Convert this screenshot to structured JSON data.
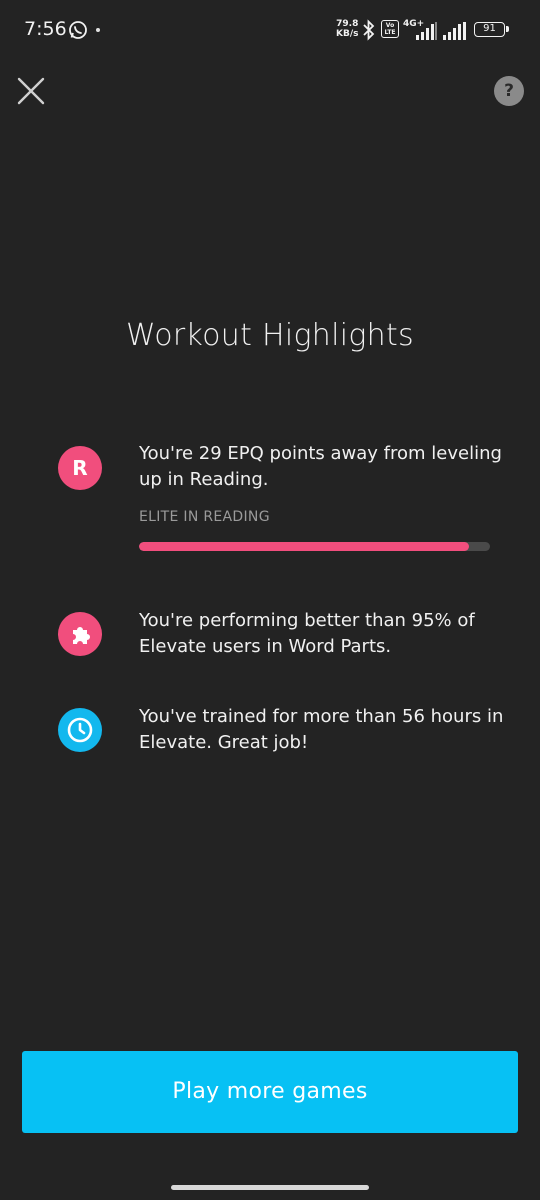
{
  "status_bar": {
    "time": "7:56",
    "net_speed_value": "79.8",
    "net_speed_unit": "KB/s",
    "volte_label": "Vo LTE",
    "network_type": "4G+",
    "battery_level": "91",
    "icons": [
      "whatsapp-icon",
      "bluetooth-icon",
      "signal-icon",
      "battery-icon"
    ]
  },
  "header": {
    "close_icon": "close-icon",
    "help_label": "?"
  },
  "main": {
    "title": "Workout Highlights",
    "highlights": [
      {
        "icon": "reading-r-icon",
        "icon_letter": "R",
        "icon_color": "#f14e7d",
        "text": "You're 29 EPQ points away from leveling up in Reading.",
        "level_label": "ELITE IN READING",
        "progress_fraction": 0.94
      },
      {
        "icon": "puzzle-icon",
        "icon_color": "#f14e7d",
        "text": "You're performing better than 95% of Elevate users in Word Parts."
      },
      {
        "icon": "clock-icon",
        "icon_color": "#13b8ee",
        "text": "You've trained for more than 56 hours in Elevate. Great job!"
      }
    ]
  },
  "footer": {
    "play_button_label": "Play more games",
    "play_button_color": "#07c1f4"
  }
}
